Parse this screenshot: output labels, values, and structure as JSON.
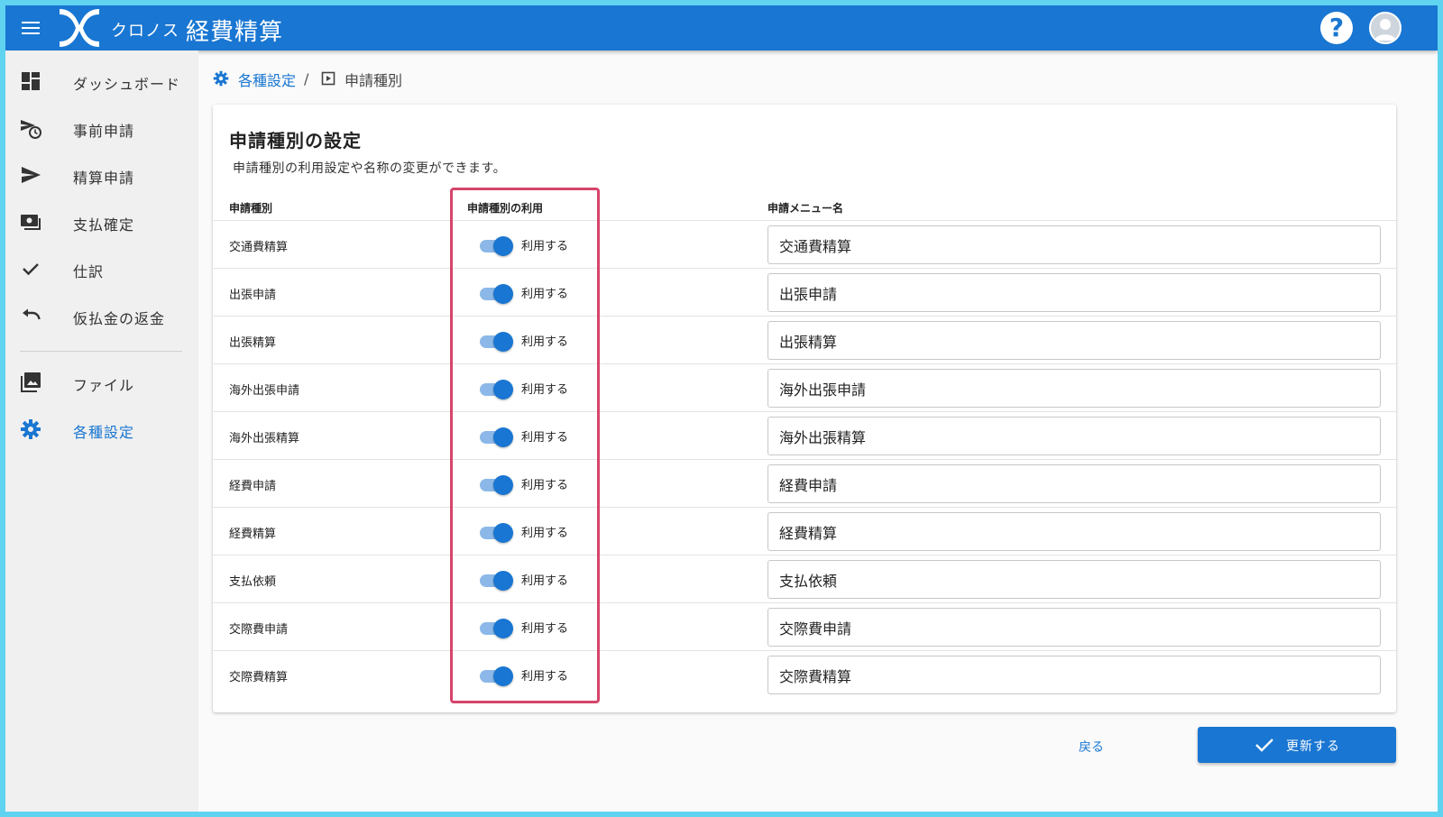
{
  "header": {
    "brand": "クロノス",
    "title": "経費精算",
    "help_label": "?"
  },
  "sidebar": {
    "items": [
      {
        "label": "ダッシュボード",
        "icon": "dashboard-icon"
      },
      {
        "label": "事前申請",
        "icon": "send-clock-icon"
      },
      {
        "label": "精算申請",
        "icon": "send-icon"
      },
      {
        "label": "支払確定",
        "icon": "payments-icon"
      },
      {
        "label": "仕訳",
        "icon": "check-icon"
      },
      {
        "label": "仮払金の返金",
        "icon": "undo-icon"
      },
      {
        "label": "ファイル",
        "icon": "photo-library-icon"
      },
      {
        "label": "各種設定",
        "icon": "gear-icon",
        "active": true
      }
    ]
  },
  "breadcrumb": {
    "settings": "各種設定",
    "separator": "/",
    "current": "申請種別"
  },
  "card": {
    "title": "申請種別の設定",
    "description": "申請種別の利用設定や名称の変更ができます。",
    "columns": [
      "申請種別",
      "申請種別の利用",
      "申請メニュー名"
    ],
    "rows": [
      {
        "type": "交通費精算",
        "enabled": true,
        "toggle_label": "利用する",
        "menu_name": "交通費精算"
      },
      {
        "type": "出張申請",
        "enabled": true,
        "toggle_label": "利用する",
        "menu_name": "出張申請"
      },
      {
        "type": "出張精算",
        "enabled": true,
        "toggle_label": "利用する",
        "menu_name": "出張精算"
      },
      {
        "type": "海外出張申請",
        "enabled": true,
        "toggle_label": "利用する",
        "menu_name": "海外出張申請"
      },
      {
        "type": "海外出張精算",
        "enabled": true,
        "toggle_label": "利用する",
        "menu_name": "海外出張精算"
      },
      {
        "type": "経費申請",
        "enabled": true,
        "toggle_label": "利用する",
        "menu_name": "経費申請"
      },
      {
        "type": "経費精算",
        "enabled": true,
        "toggle_label": "利用する",
        "menu_name": "経費精算"
      },
      {
        "type": "支払依頼",
        "enabled": true,
        "toggle_label": "利用する",
        "menu_name": "支払依頼"
      },
      {
        "type": "交際費申請",
        "enabled": true,
        "toggle_label": "利用する",
        "menu_name": "交際費申請"
      },
      {
        "type": "交際費精算",
        "enabled": true,
        "toggle_label": "利用する",
        "menu_name": "交際費精算"
      }
    ]
  },
  "footer": {
    "back_label": "戻る",
    "update_label": "更新する"
  },
  "colors": {
    "primary": "#1976d2",
    "highlight_border": "#d6446b",
    "toggle_track": "#8bb8e8"
  }
}
